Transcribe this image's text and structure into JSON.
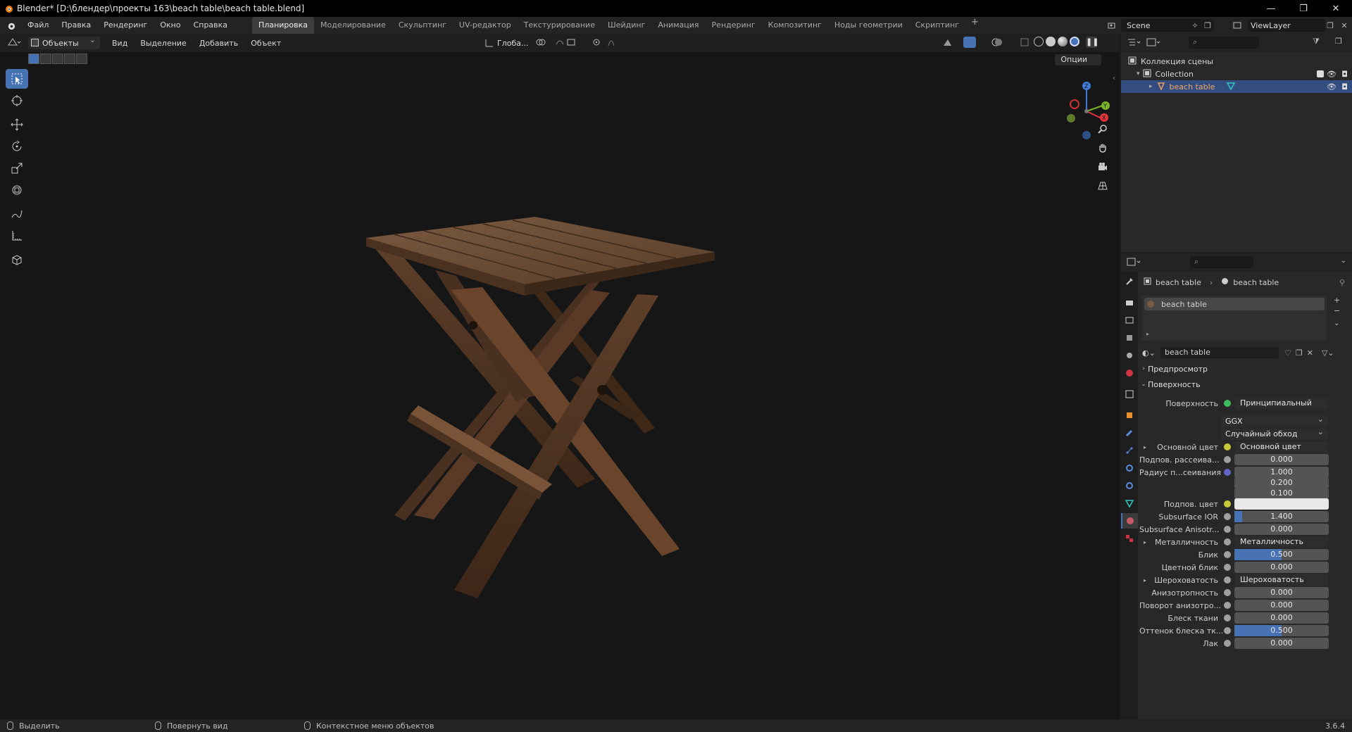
{
  "window": {
    "title": "Blender* [D:\\блендер\\проекты 163\\beach table\\beach table.blend]",
    "minimize": "—",
    "restore": "❐",
    "close": "✕"
  },
  "menubar": {
    "items": [
      "Файл",
      "Правка",
      "Рендеринг",
      "Окно",
      "Справка"
    ],
    "workspaces": [
      "Планировка",
      "Моделирование",
      "Скульптинг",
      "UV-редактор",
      "Текстурирование",
      "Шейдинг",
      "Анимация",
      "Рендеринг",
      "Композитинг",
      "Ноды геометрии",
      "Скриптинг"
    ],
    "active_workspace": "Планировка",
    "add_tab": "+",
    "scene": "Scene",
    "view_layer": "ViewLayer"
  },
  "viewport": {
    "mode": "Объекты",
    "menus": [
      "Вид",
      "Выделение",
      "Добавить",
      "Объект"
    ],
    "orientation": "Глоба...",
    "options": "Опции",
    "gizmo_labels": {
      "x": "X",
      "y": "Y",
      "z": "Z"
    }
  },
  "outliner": {
    "rows": [
      {
        "label": "Коллекция сцены"
      },
      {
        "label": "Collection"
      },
      {
        "label": "beach table"
      }
    ]
  },
  "properties": {
    "breadcrumb": [
      "beach table",
      "beach table"
    ],
    "material_slot": "beach table",
    "material_name": "beach table",
    "sections": {
      "preview": "Предпросмотр",
      "surface": "Поверхность"
    },
    "surface": {
      "label": "Поверхность",
      "value": "Принципиальный BSDF"
    },
    "distribution": "GGX",
    "subsurface_method": "Случайный обход",
    "rows": [
      {
        "label": "Основной цвет",
        "value": "Основной цвет",
        "kind": "link",
        "dot": "#c8c83a"
      },
      {
        "label": "Подпов. рассеива...",
        "value": "0.000",
        "kind": "num",
        "dot": "#a0a0a0"
      },
      {
        "label": "Радиус п...сеивания",
        "value": "1.000",
        "kind": "num",
        "dot": "#6363c7"
      },
      {
        "label": "",
        "value": "0.200",
        "kind": "num"
      },
      {
        "label": "",
        "value": "0.100",
        "kind": "num"
      },
      {
        "label": "Подпов. цвет",
        "value": "",
        "kind": "color",
        "dot": "#c8c83a"
      },
      {
        "label": "Subsurface IOR",
        "value": "1.400",
        "kind": "num",
        "dot": "#a0a0a0",
        "fill": 0.08
      },
      {
        "label": "Subsurface Anisotr...",
        "value": "0.000",
        "kind": "num",
        "dot": "#a0a0a0"
      },
      {
        "label": "Металличность",
        "value": "Металличность",
        "kind": "link",
        "dot": "#a0a0a0"
      },
      {
        "label": "Блик",
        "value": "0.500",
        "kind": "num",
        "dot": "#a0a0a0",
        "fill": 0.5
      },
      {
        "label": "Цветной блик",
        "value": "0.000",
        "kind": "num",
        "dot": "#a0a0a0"
      },
      {
        "label": "Шероховатость",
        "value": "Шероховатость",
        "kind": "link",
        "dot": "#a0a0a0"
      },
      {
        "label": "Анизотропность",
        "value": "0.000",
        "kind": "num",
        "dot": "#a0a0a0"
      },
      {
        "label": "Поворот анизотро...",
        "value": "0.000",
        "kind": "num",
        "dot": "#a0a0a0"
      },
      {
        "label": "Блеск ткани",
        "value": "0.000",
        "kind": "num",
        "dot": "#a0a0a0"
      },
      {
        "label": "Оттенок блеска тк...",
        "value": "0.500",
        "kind": "num",
        "dot": "#a0a0a0",
        "fill": 0.5
      },
      {
        "label": "Лак",
        "value": "0.000",
        "kind": "num",
        "dot": "#a0a0a0"
      }
    ]
  },
  "statusbar": {
    "select": "Выделить",
    "rotate": "Повернуть вид",
    "context": "Контекстное меню объектов",
    "version": "3.6.4"
  }
}
